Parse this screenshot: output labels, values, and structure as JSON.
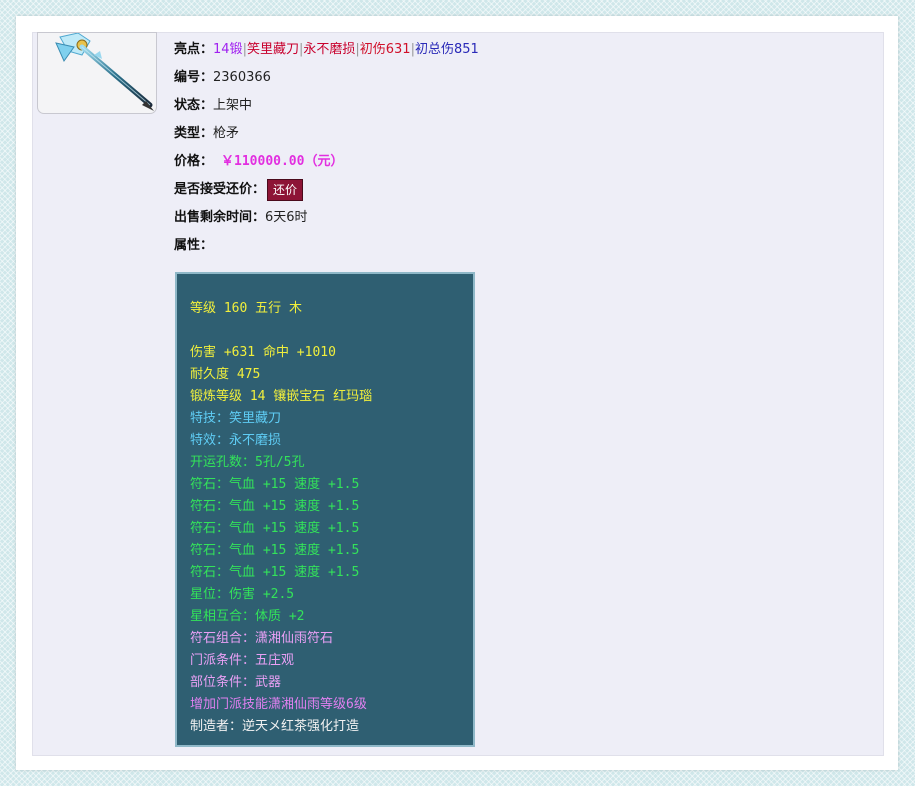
{
  "item": {
    "highlights_label": "亮点：",
    "highlights": [
      "14锻",
      "笑里藏刀",
      "永不磨损",
      "初伤631",
      "初总伤851"
    ],
    "highlight_colors": [
      "#a020f0",
      "#c8002d",
      "#c8002d",
      "#d0102a",
      "#2a2ab8"
    ],
    "separator": "|",
    "id_label": "编号：",
    "id": "2360366",
    "status_label": "状态：",
    "status": "上架中",
    "type_label": "类型：",
    "type": "枪矛",
    "price_label": "价格：",
    "price": "￥110000.00（元）",
    "bargain_label": "是否接受还价：",
    "bargain_button": "还价",
    "time_left_label": "出售剩余时间：",
    "time_left": "6天6时",
    "attributes_label": "属性："
  },
  "attributes": {
    "level": "等级 160 五行 木",
    "damage": "伤害 +631 命中 +1010",
    "durability": "耐久度 475",
    "forge": "锻炼等级 14 镶嵌宝石 红玛瑙",
    "skill": "特技：笑里藏刀",
    "effect": "特效：永不磨损",
    "holes": "开运孔数：5孔/5孔",
    "runes": [
      "符石：气血 +15 速度 +1.5",
      "符石：气血 +15 速度 +1.5",
      "符石：气血 +15 速度 +1.5",
      "符石：气血 +15 速度 +1.5",
      "符石：气血 +15 速度 +1.5"
    ],
    "star_position": "星位：伤害 +2.5",
    "star_match": "星相互合：体质 +2",
    "rune_combo": "符石组合：潇湘仙雨符石",
    "sect_condition": "门派条件：五庄观",
    "slot_condition": "部位条件：武器",
    "sect_skill_bonus": "增加门派技能潇湘仙雨等级6级",
    "maker": "制造者：逆天メ红茶强化打造"
  },
  "colors": {
    "attr_bg": "#2f5f72",
    "yellow": "#f1ef3c",
    "cyan": "#5fcdf5",
    "green": "#33e35a",
    "pink": "#e9a0f5",
    "price": "#e22fe0",
    "button": "#8d1436"
  },
  "icons": {
    "item_image": "spear-weapon-icon"
  }
}
